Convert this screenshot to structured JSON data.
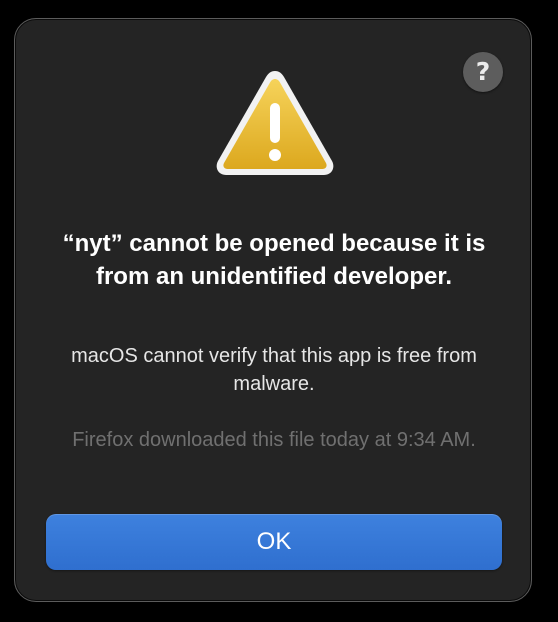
{
  "dialog": {
    "help_icon": "question-mark-icon",
    "help_label": "?",
    "warning_icon": "warning-triangle-icon",
    "title": "“nyt” cannot be opened because it is from an unidentified developer.",
    "message": "macOS cannot verify that this app is free from malware.",
    "info": "Firefox downloaded this file today at 9:34 AM.",
    "ok_label": "OK"
  },
  "colors": {
    "background": "#000000",
    "dialog_bg": "#242424",
    "accent": "#3478dc",
    "warning_yellow": "#e8b628",
    "text_primary": "#ffffff",
    "text_secondary": "#707070"
  }
}
